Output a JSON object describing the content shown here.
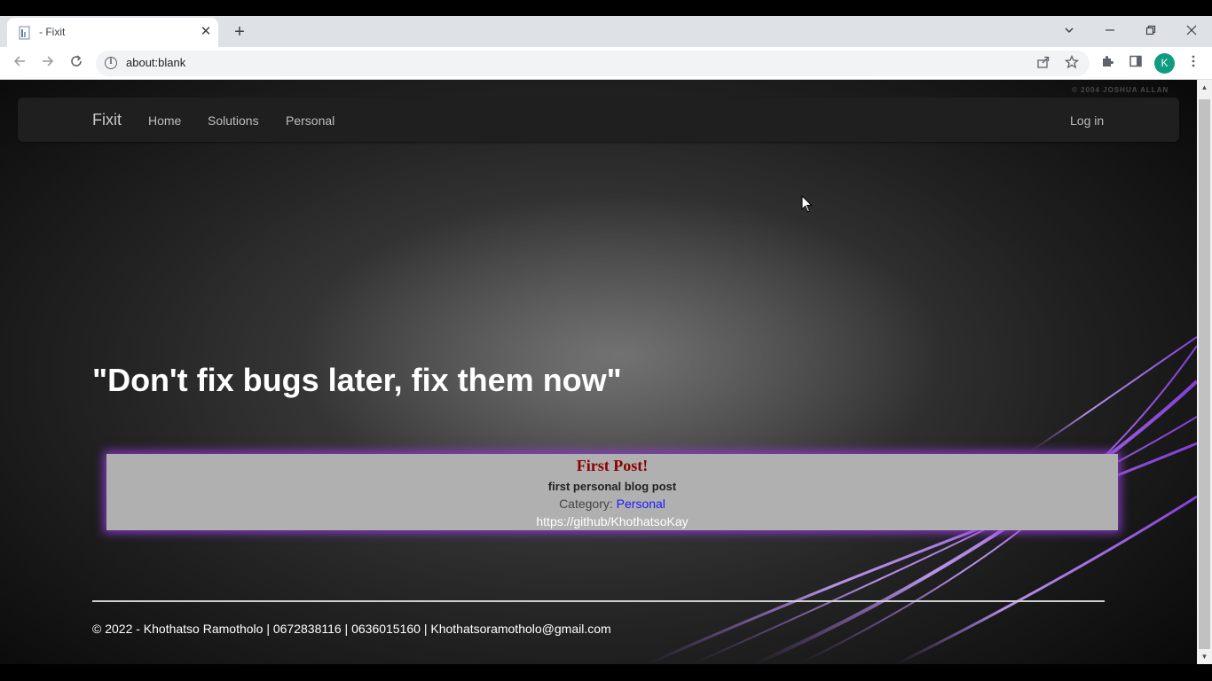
{
  "browser": {
    "tab_title": "- Fixit",
    "url": "about:blank",
    "profile_initial": "K",
    "icons": [
      "page-favicon",
      "close-icon",
      "plus-icon",
      "chevron-down-icon",
      "minimize-icon",
      "restore-icon",
      "close-window-icon",
      "back-arrow-icon",
      "forward-arrow-icon",
      "reload-icon",
      "info-icon",
      "share-icon",
      "star-icon",
      "puzzle-icon",
      "side-panel-icon",
      "kebab-menu-icon"
    ]
  },
  "page": {
    "watermark": "© 2004 JOSHUA ALLAN",
    "nav": {
      "brand": "Fixit",
      "links": [
        "Home",
        "Solutions",
        "Personal"
      ],
      "login": "Log in"
    },
    "quote": "\"Don't fix bugs later, fix them now\"",
    "post": {
      "title": "First Post!",
      "description": "first personal blog post",
      "category_label": "Category: ",
      "category_value": "Personal",
      "link": "https://github/KhothatsoKay"
    },
    "footer": "© 2022 - Khothatso Ramotholo | 0672838116 | 0636015160 | Khothatsoramotholo@gmail.com"
  },
  "colors": {
    "navbar_bg": "#1f1f1f",
    "post_bg": "#b0b0b0",
    "post_glow": "#9b3cdc",
    "post_title": "#8b0000",
    "category_link": "#1a1aff",
    "avatar": "#0f9d82"
  }
}
